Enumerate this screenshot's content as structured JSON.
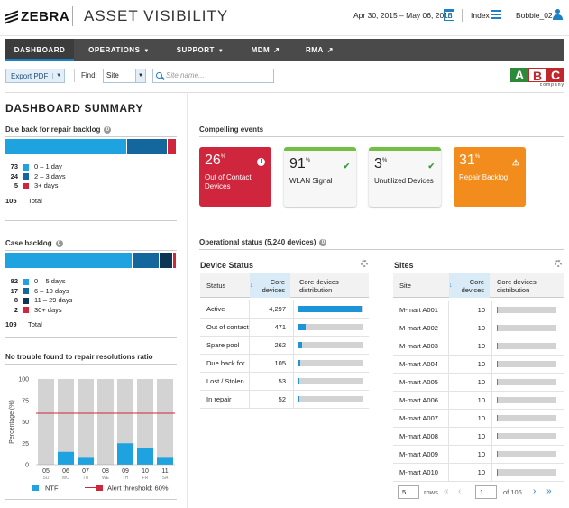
{
  "header": {
    "logo": "ZEBRA",
    "app_title": "ASSET VISIBILITY",
    "date_range": "Apr 30, 2015 – May 06, 2015",
    "index_label": "Index",
    "user": "Bobbie_02"
  },
  "nav": {
    "items": [
      {
        "label": "DASHBOARD",
        "active": true
      },
      {
        "label": "OPERATIONS",
        "suffix": "▼"
      },
      {
        "label": "SUPPORT",
        "suffix": "▼"
      },
      {
        "label": "MDM",
        "suffix": "↗"
      },
      {
        "label": "RMA",
        "suffix": "↗"
      }
    ]
  },
  "toolbar": {
    "export_label": "Export PDF",
    "find_label": "Find:",
    "find_select": "Site",
    "search_placeholder": "Site name...",
    "brand_letters": [
      "A",
      "B",
      "C"
    ],
    "brand_sub": "company"
  },
  "page_title": "DASHBOARD SUMMARY",
  "due_back": {
    "title": "Due back for repair backlog",
    "info": "0",
    "segments": [
      {
        "value": 73,
        "label": "0 – 1 day",
        "color": "#1ea3e0"
      },
      {
        "value": 24,
        "label": "2 – 3 days",
        "color": "#13679c"
      },
      {
        "value": 5,
        "label": "3+ days",
        "color": "#d0263d"
      }
    ],
    "total_label": "Total",
    "total": 105
  },
  "case_backlog": {
    "title": "Case backlog",
    "info": "0",
    "segments": [
      {
        "value": 82,
        "label": "0 – 5 days",
        "color": "#1ea3e0"
      },
      {
        "value": 17,
        "label": "6 – 10 days",
        "color": "#13679c"
      },
      {
        "value": 8,
        "label": "11 – 29 days",
        "color": "#0d3554"
      },
      {
        "value": 2,
        "label": "30+ days",
        "color": "#d0263d"
      }
    ],
    "total_label": "Total",
    "total": 109
  },
  "ntf_chart_title": "No trouble found to repair resolutions ratio",
  "chart_data": {
    "type": "bar",
    "title": "No trouble found to repair resolutions ratio",
    "categories": [
      "05",
      "06",
      "07",
      "08",
      "09",
      "10",
      "11"
    ],
    "day_labels": [
      "SU",
      "MO",
      "TU",
      "WE",
      "TH",
      "FR",
      "SA"
    ],
    "series": [
      {
        "name": "NTF",
        "values": [
          0,
          15,
          8,
          0,
          25,
          19,
          8
        ]
      }
    ],
    "threshold": {
      "name": "Alert threshold: 60%",
      "value": 60
    },
    "ylabel": "Percentage (%)",
    "yticks": [
      0,
      25,
      50,
      75,
      100
    ],
    "ylim": [
      0,
      100
    ],
    "colors": {
      "bar": "#1ea3e0",
      "background": "#d3d3d3",
      "threshold": "#d0263d"
    }
  },
  "compelling": {
    "title": "Compelling events",
    "cards": [
      {
        "value": "26",
        "unit": "%",
        "label": "Out of Contact Devices",
        "icon": "!",
        "style": "red"
      },
      {
        "value": "91",
        "unit": "%",
        "label": "WLAN Signal",
        "icon": "✔",
        "style": "white"
      },
      {
        "value": "3",
        "unit": "%",
        "label": "Unutilized Devices",
        "icon": "✔",
        "style": "white"
      },
      {
        "value": "31",
        "unit": "%",
        "label": "Repair Backlog",
        "icon": "⚠",
        "style": "orange"
      }
    ]
  },
  "operational": {
    "title": "Operational status (5,240 devices)",
    "info": "0"
  },
  "device_status": {
    "title": "Device Status",
    "columns": [
      "Status",
      "Core devices",
      "Core devices distribution"
    ],
    "rows": [
      {
        "status": "Active",
        "count": "4,297",
        "fraction": 0.82
      },
      {
        "status": "Out of contact",
        "count": "471",
        "fraction": 0.09
      },
      {
        "status": "Spare pool",
        "count": "262",
        "fraction": 0.05
      },
      {
        "status": "Due back for...",
        "count": "105",
        "fraction": 0.02
      },
      {
        "status": "Lost / Stolen",
        "count": "53",
        "fraction": 0.01
      },
      {
        "status": "In repair",
        "count": "52",
        "fraction": 0.01
      }
    ]
  },
  "sites": {
    "title": "Sites",
    "columns": [
      "Site",
      "Core devices",
      "Core devices distribution"
    ],
    "rows": [
      {
        "site": "M-mart A001",
        "count": "10",
        "fraction": 0.01
      },
      {
        "site": "M-mart A002",
        "count": "10",
        "fraction": 0.01
      },
      {
        "site": "M-mart A003",
        "count": "10",
        "fraction": 0.01
      },
      {
        "site": "M-mart A004",
        "count": "10",
        "fraction": 0.01
      },
      {
        "site": "M-mart A005",
        "count": "10",
        "fraction": 0.01
      },
      {
        "site": "M-mart A006",
        "count": "10",
        "fraction": 0.01
      },
      {
        "site": "M-mart A007",
        "count": "10",
        "fraction": 0.01
      },
      {
        "site": "M-mart A008",
        "count": "10",
        "fraction": 0.01
      },
      {
        "site": "M-mart A009",
        "count": "10",
        "fraction": 0.01
      },
      {
        "site": "M-mart A010",
        "count": "10",
        "fraction": 0.01
      }
    ],
    "pager": {
      "rows_value": "5",
      "rows_label": "rows",
      "page": "1",
      "of_label": "of 106"
    }
  }
}
